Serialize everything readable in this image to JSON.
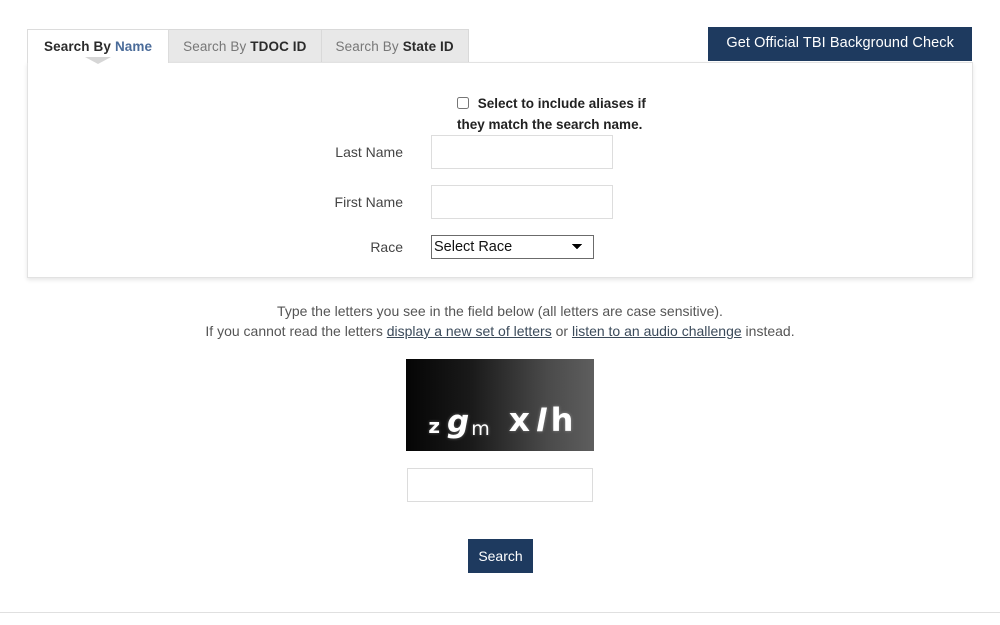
{
  "tabs": [
    {
      "prefix": "Search By ",
      "emphasis": "Name",
      "active": true
    },
    {
      "prefix": "Search By ",
      "emphasis": "TDOC ID",
      "active": false
    },
    {
      "prefix": "Search By ",
      "emphasis": "State ID",
      "active": false
    }
  ],
  "header": {
    "tbi_button_label": "Get Official TBI Background Check"
  },
  "form": {
    "alias_checkbox_label": "Select to include aliases if they match the search name.",
    "alias_checked": false,
    "last_name": {
      "label": "Last Name",
      "value": "",
      "placeholder": ""
    },
    "first_name": {
      "label": "First Name",
      "value": "",
      "placeholder": ""
    },
    "race": {
      "label": "Race",
      "selected": "Select Race",
      "options": [
        "Select Race"
      ]
    }
  },
  "captcha": {
    "line1": "Type the letters you see in the field below (all letters are case sensitive).",
    "line2_part1": "If you cannot read the letters ",
    "link_new_letters": "display a new set of letters",
    "line2_part2": " or ",
    "link_audio": "listen to an audio challenge",
    "line2_part3": " instead.",
    "challenge_text": "zgm xlh",
    "letters": [
      "z",
      "g",
      "m",
      "x",
      "l",
      "h"
    ],
    "input_value": "",
    "input_placeholder": ""
  },
  "actions": {
    "search_label": "Search"
  },
  "colors": {
    "navy": "#1e3a5f",
    "tab_active_accent": "#4a6b99",
    "tab_strip_bg": "#e8e8e8"
  }
}
